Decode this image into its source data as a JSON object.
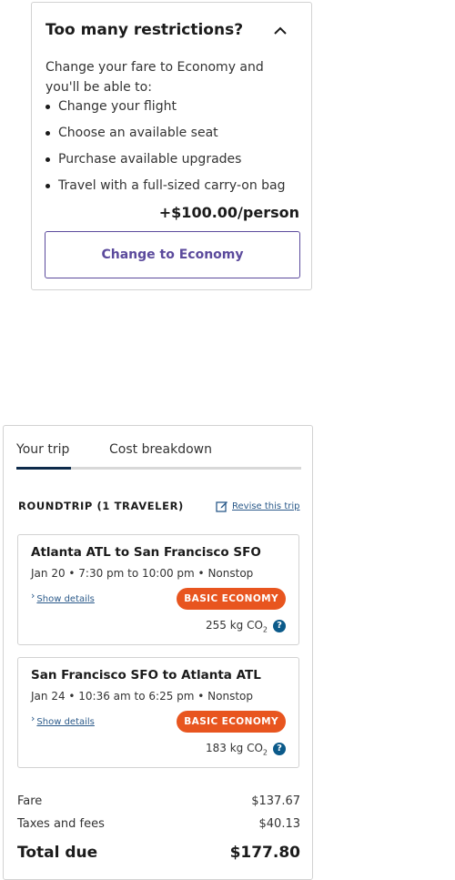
{
  "upsell": {
    "title": "Too many restrictions?",
    "description": "Change your fare to Economy and you'll be able to:",
    "perks": [
      "Change your flight",
      "Choose an available seat",
      "Purchase available upgrades",
      "Travel with a full-sized carry-on bag"
    ],
    "price": "+$100.00/person",
    "button_label": "Change to Economy",
    "accent_color": "#5b4a9c"
  },
  "trip": {
    "tabs": [
      {
        "label": "Your trip",
        "active": true
      },
      {
        "label": "Cost breakdown",
        "active": false
      }
    ],
    "heading": "ROUNDTRIP (1 TRAVELER)",
    "revise_label": "Revise this trip",
    "flights": [
      {
        "route": "Atlanta ATL to San Francisco SFO",
        "schedule": "Jan 20 • 7:30 pm to 10:00 pm • Nonstop",
        "details_label": "Show details",
        "fare_badge": "BASIC ECONOMY",
        "co2_value": "255 kg CO",
        "co2_sub": "2"
      },
      {
        "route": "San Francisco SFO to Atlanta ATL",
        "schedule": "Jan 24 • 10:36 am to 6:25 pm • Nonstop",
        "details_label": "Show details",
        "fare_badge": "BASIC ECONOMY",
        "co2_value": "183 kg CO",
        "co2_sub": "2"
      }
    ],
    "summary": {
      "fare_label": "Fare",
      "fare_value": "$137.67",
      "taxes_label": "Taxes and fees",
      "taxes_value": "$40.13",
      "total_label": "Total due",
      "total_value": "$177.80"
    },
    "badge_color": "#e8551f"
  }
}
